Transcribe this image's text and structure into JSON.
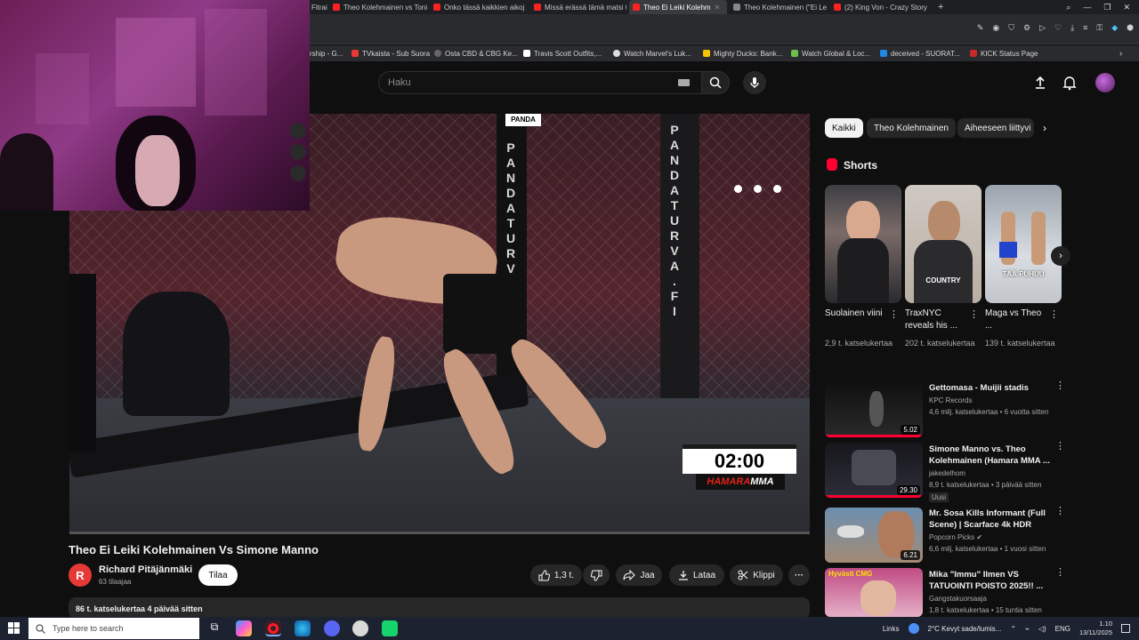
{
  "browser": {
    "tabs": [
      {
        "title": "Theo Kolehmainen vs Toni",
        "active": false
      },
      {
        "title": "Onko tässä kaikkien aikoj",
        "active": false
      },
      {
        "title": "Missä erässä tämä matsi t",
        "active": false
      },
      {
        "title": "Theo Ei Leiki Kolehm",
        "active": true
      },
      {
        "title": "Theo Kolehmainen (\"Ei Le",
        "active": false
      },
      {
        "title": "(2) King Von - Crazy Story",
        "active": false
      }
    ],
    "partial_tab": "Fitrai",
    "new_tab": "+",
    "window_controls": [
      "⌕",
      "—",
      "❐",
      "✕"
    ],
    "bookmarks": [
      {
        "label": "rship - G...",
        "color": "#5a8f3a"
      },
      {
        "label": "TVkaista - Sub Suora",
        "color": "#e53935"
      },
      {
        "label": "Osta CBD & CBG Ke...",
        "color": "#888888"
      },
      {
        "label": "Travis Scott Outfits,...",
        "color": "#ffffff"
      },
      {
        "label": "Watch Marvel's Luk...",
        "color": "#dddddd"
      },
      {
        "label": "Mighty Ducks: Bank...",
        "color": "#f5c400"
      },
      {
        "label": "Watch Global & Loc...",
        "color": "#6cc04a"
      },
      {
        "label": "deceived - SUORAT...",
        "color": "#1e88e5"
      },
      {
        "label": "KICK Status Page",
        "color": "#c62828"
      }
    ]
  },
  "youtube": {
    "search_placeholder": "Haku",
    "video": {
      "title": "Theo Ei Leiki Kolehmainen Vs Simone Manno",
      "timer": "02:00",
      "brand_a": "HAMARA",
      "brand_b": "MMA",
      "post_text_1": "PANDATURVA",
      "post_text_2": "PANDATURVA.FI",
      "panda_sign": "PANDA"
    },
    "channel": {
      "initial": "R",
      "name": "Richard Pitäjänmäki",
      "subscribers": "63 tilaajaa",
      "subscribe_label": "Tilaa"
    },
    "actions": {
      "like_count": "1,3 t.",
      "share": "Jaa",
      "download": "Lataa",
      "clip": "Klippi",
      "more": "···"
    },
    "description": "86 t. katselukertaa  4 päivää sitten",
    "chips": [
      "Kaikki",
      "Theo Kolehmainen",
      "Aiheeseen liittyvi"
    ],
    "shorts_header": "Shorts",
    "shorts": [
      {
        "title": "Suolainen viini",
        "views": "2,9 t. katselukertaa"
      },
      {
        "title": "TraxNYC reveals his ...",
        "views": "202 t. katselukertaa",
        "overlay": "COUNTRY"
      },
      {
        "title": "Maga vs Theo ...",
        "views": "139 t. katselukertaa",
        "overlay": "TÄÄ PUHUU"
      }
    ],
    "recommendations": [
      {
        "title": "Gettomasa - Muijii stadis",
        "channel": "KPC Records",
        "meta": "4,6 milj. katselukertaa • 6 vuotta sitten",
        "duration": "5.02"
      },
      {
        "title": "Simone Manno vs. Theo Kolehmainen (Hamara MMA ...",
        "channel": "jakedelhom",
        "meta": "8,9 t. katselukertaa • 3 päivää sitten",
        "duration": "29.30",
        "badge": "Uusi"
      },
      {
        "title": "Mr. Sosa Kills Informant (Full Scene) | Scarface 4k HDR",
        "channel": "Popcorn Picks ✔",
        "meta": "6,6 milj. katselukertaa • 1 vuosi sitten",
        "duration": "6.21"
      },
      {
        "title": "Mika \"Immu\" Ilmen VS TATUOINTI POISTO 2025!! ...",
        "channel": "Gangstakuorsaaja",
        "meta": "1,8 t. katselukertaa • 15 tuntia sitten",
        "duration": "",
        "thumb_text": "Hyvästi CMG"
      }
    ]
  },
  "taskbar": {
    "search_placeholder": "Type here to search",
    "links": "Links",
    "weather": "2°C  Kevyt sade/lumis...",
    "lang": "ENG",
    "time": "1.10",
    "date": "13/11/2025"
  },
  "colors": {
    "background": "#0f0f0f",
    "accent_red": "#ff0033",
    "chip_bg": "#272727"
  }
}
